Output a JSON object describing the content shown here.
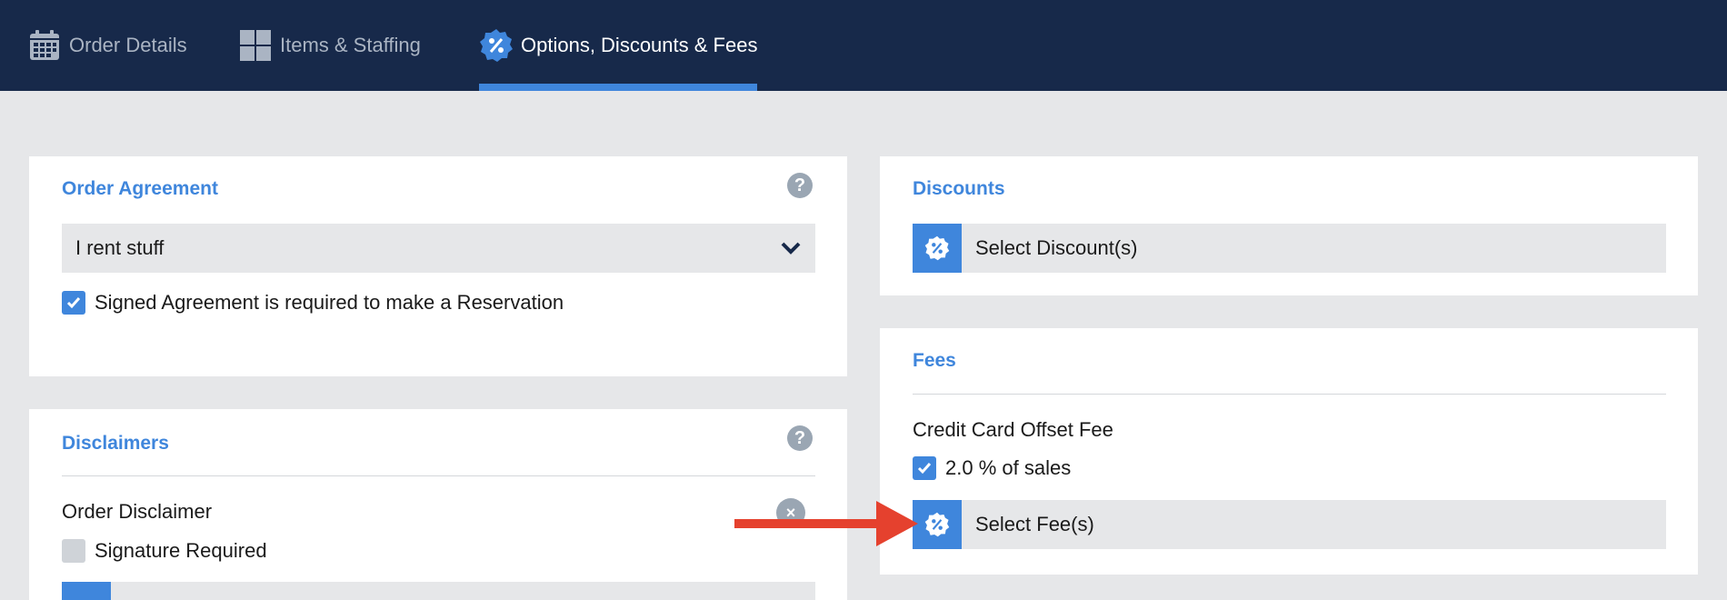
{
  "tabs": [
    {
      "label": "Order Details",
      "icon": "calendar-icon"
    },
    {
      "label": "Items & Staffing",
      "icon": "grid-icon"
    },
    {
      "label": "Options, Discounts & Fees",
      "icon": "badge-percent-icon",
      "active": true
    }
  ],
  "agreement": {
    "title": "Order Agreement",
    "help": "?",
    "selected": "I rent stuff",
    "checkbox_label": "Signed Agreement is required to make a Reservation",
    "checkbox_checked": true
  },
  "disclaimers": {
    "title": "Disclaimers",
    "help": "?",
    "item_label": "Order Disclaimer",
    "remove": "×",
    "signature_label": "Signature Required",
    "signature_checked": false
  },
  "discounts": {
    "title": "Discounts",
    "button_label": "Select Discount(s)"
  },
  "fees": {
    "title": "Fees",
    "fee_name": "Credit Card Offset Fee",
    "fee_checkbox_label": "2.0 % of sales",
    "fee_checked": true,
    "button_label": "Select Fee(s)"
  },
  "colors": {
    "topbar": "#17294a",
    "accent": "#3f86dc",
    "annotation_arrow": "#e5412e"
  }
}
